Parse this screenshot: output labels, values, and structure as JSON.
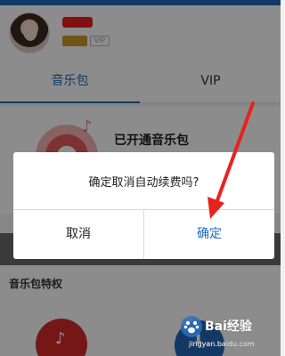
{
  "profile": {
    "username": "",
    "level_badge": "",
    "vip_badge": "VIP"
  },
  "tabs": [
    {
      "label": "音乐包"
    },
    {
      "label": "VIP"
    }
  ],
  "package": {
    "status": "已开通音乐包"
  },
  "privileges": {
    "title": "音乐包特权"
  },
  "dialog": {
    "message": "确定取消自动续费吗?",
    "cancel_label": "取消",
    "confirm_label": "确定"
  },
  "watermark": {
    "brand": "Bai经验",
    "url": "jingyan.baidu.com"
  },
  "colors": {
    "accent": "#1e6bb8",
    "arrow": "#e8221f"
  },
  "icons": {
    "music_note": "♪",
    "privilege_1": "♪",
    "privilege_2": "⬇"
  }
}
